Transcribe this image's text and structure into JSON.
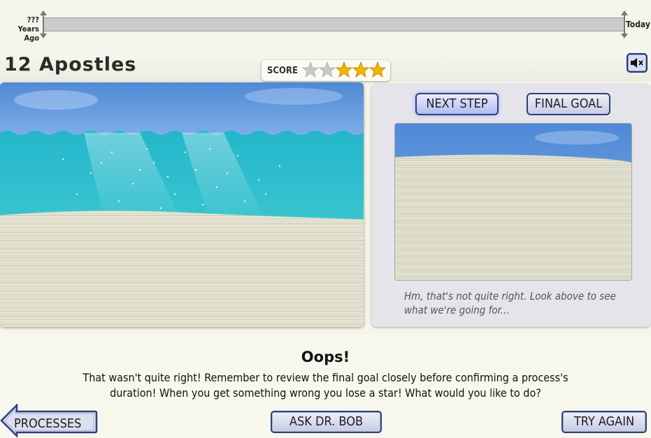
{
  "timeline": {
    "start_label_line1": "???",
    "start_label_line2": "Years Ago",
    "end_label": "Today"
  },
  "header": {
    "title": "12 Apostles",
    "score_label": "SCORE",
    "stars_total": 5,
    "stars_filled": 3,
    "sound_icon": "speaker-muted-icon"
  },
  "panel": {
    "next_step_label": "NEXT STEP",
    "final_goal_label": "FINAL GOAL",
    "hint": "Hm, that's not quite right. Look above to see what we're going for..."
  },
  "message": {
    "title": "Oops!",
    "body": "That wasn't quite right! Remember to review the final goal closely before confirming a process's duration! When you get something wrong you lose a star! What would you like to do?"
  },
  "actions": {
    "processes_label": "PROCESSES",
    "ask_label": "ASK DR. BOB",
    "try_again_label": "TRY AGAIN"
  },
  "colors": {
    "accent_border": "#2d3f7b",
    "star_gold": "#f5b400",
    "star_grey": "#c8c8c8",
    "water": "#3cc4cf",
    "sky": "#5b93d8",
    "sediment": "#e6e3d4"
  }
}
